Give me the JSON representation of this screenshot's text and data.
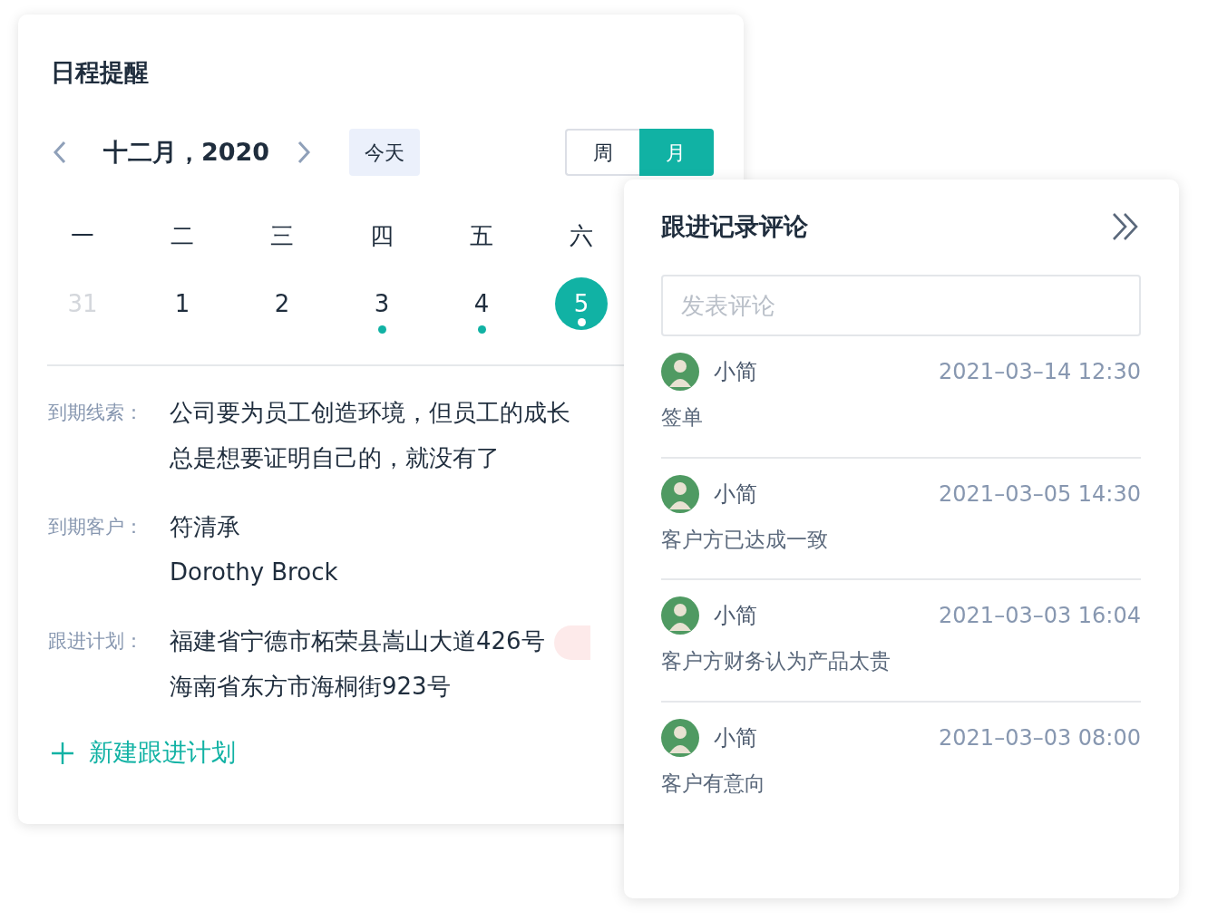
{
  "schedule": {
    "title": "日程提醒",
    "month_label": "十二月，2020",
    "today_button": "今天",
    "view_toggle": [
      {
        "label": "周",
        "selected": false
      },
      {
        "label": "月",
        "selected": true
      }
    ],
    "weekdays": [
      "一",
      "二",
      "三",
      "四",
      "五",
      "六"
    ],
    "days": [
      {
        "label": "31",
        "other_month": true,
        "has_event": false,
        "selected": false
      },
      {
        "label": "1",
        "other_month": false,
        "has_event": false,
        "selected": false
      },
      {
        "label": "2",
        "other_month": false,
        "has_event": false,
        "selected": false
      },
      {
        "label": "3",
        "other_month": false,
        "has_event": true,
        "selected": false
      },
      {
        "label": "4",
        "other_month": false,
        "has_event": true,
        "selected": false
      },
      {
        "label": "5",
        "other_month": false,
        "has_event": true,
        "selected": true
      }
    ],
    "details": [
      {
        "label": "到期线索：",
        "lines": [
          "公司要为员工创造环境，但员工的成长",
          "总是想要证明自己的，就没有了"
        ],
        "tag": false
      },
      {
        "label": "到期客户：",
        "lines": [
          "符清承",
          "Dorothy Brock"
        ],
        "tag": false
      },
      {
        "label": "跟进计划：",
        "lines": [
          "福建省宁德市柘荣县嵩山大道426号",
          "海南省东方市海桐街923号"
        ],
        "tag": true
      }
    ],
    "add_link": "新建跟进计划"
  },
  "comments_panel": {
    "title": "跟进记录评论",
    "input": {
      "placeholder": "发表评论"
    },
    "comments": [
      {
        "author": "小简",
        "time": "2021–03–14 12:30",
        "text": "签单"
      },
      {
        "author": "小简",
        "time": "2021–03–05 14:30",
        "text": "客户方已达成一致"
      },
      {
        "author": "小简",
        "time": "2021–03–03 16:04",
        "text": "客户方财务认为产品太贵"
      },
      {
        "author": "小简",
        "time": "2021–03–03 08:00",
        "text": "客户有意向"
      }
    ]
  }
}
